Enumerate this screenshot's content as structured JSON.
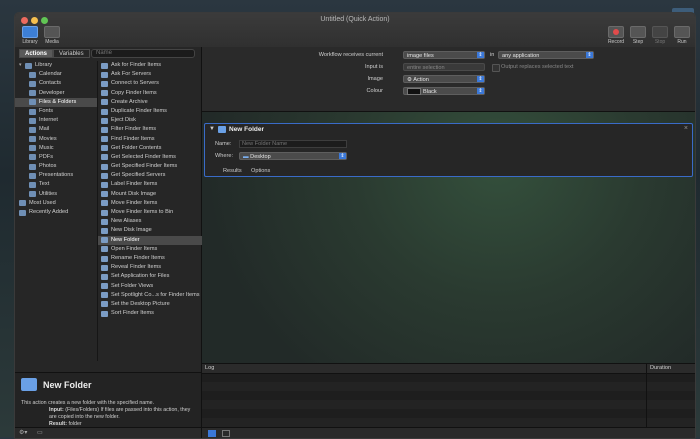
{
  "window": {
    "title": "Untitled (Quick Action)"
  },
  "toolbar": {
    "library": "Library",
    "media": "Media",
    "record": "Record",
    "step": "Step",
    "stop": "Stop",
    "run": "Run"
  },
  "left": {
    "tabs": {
      "actions": "Actions",
      "variables": "Variables"
    },
    "search_placeholder": "Name",
    "categories": [
      "Library",
      "Calendar",
      "Contacts",
      "Developer",
      "Files & Folders",
      "Fonts",
      "Internet",
      "Mail",
      "Movies",
      "Music",
      "PDFs",
      "Photos",
      "Presentations",
      "Text",
      "Utilities",
      "Most Used",
      "Recently Added"
    ],
    "actions": [
      "Ask for Finder Items",
      "Ask For Servers",
      "Connect to Servers",
      "Copy Finder Items",
      "Create Archive",
      "Duplicate Finder Items",
      "Eject Disk",
      "Filter Finder Items",
      "Find Finder Items",
      "Get Folder Contents",
      "Get Selected Finder Items",
      "Get Specified Finder Items",
      "Get Specified Servers",
      "Label Finder Items",
      "Mount Disk Image",
      "Move Finder Items",
      "Move Finder Items to Bin",
      "New Aliases",
      "New Disk Image",
      "New Folder",
      "Open Finder Items",
      "Rename Finder Items",
      "Reveal Finder Items",
      "Set Application for Files",
      "Set Folder Views",
      "Set Spotlight Co...s for Finder Items",
      "Set the Desktop Picture",
      "Sort Finder Items"
    ],
    "description": {
      "title": "New Folder",
      "text": "This action creates a new folder with the specified name.",
      "input_label": "Input:",
      "input_text": "(Files/Folders) If files are passed into this action, they are copied into the new folder.",
      "result_label": "Result:",
      "result_text": "folder"
    }
  },
  "workflow": {
    "receives_label": "Workflow receives current",
    "receives_value": "image files",
    "in_label": "in",
    "in_value": "any application",
    "input_is_label": "Input is",
    "input_is_value": "entire selection",
    "output_replaces": "Output replaces selected text",
    "image_label": "Image",
    "image_value": "Action",
    "colour_label": "Colour",
    "colour_value": "Black"
  },
  "action_card": {
    "title": "New Folder",
    "name_label": "Name:",
    "name_placeholder": "New Folder Name",
    "where_label": "Where:",
    "where_value": "Desktop",
    "results_tab": "Results",
    "options_tab": "Options"
  },
  "log": {
    "log_header": "Log",
    "duration_header": "Duration"
  }
}
